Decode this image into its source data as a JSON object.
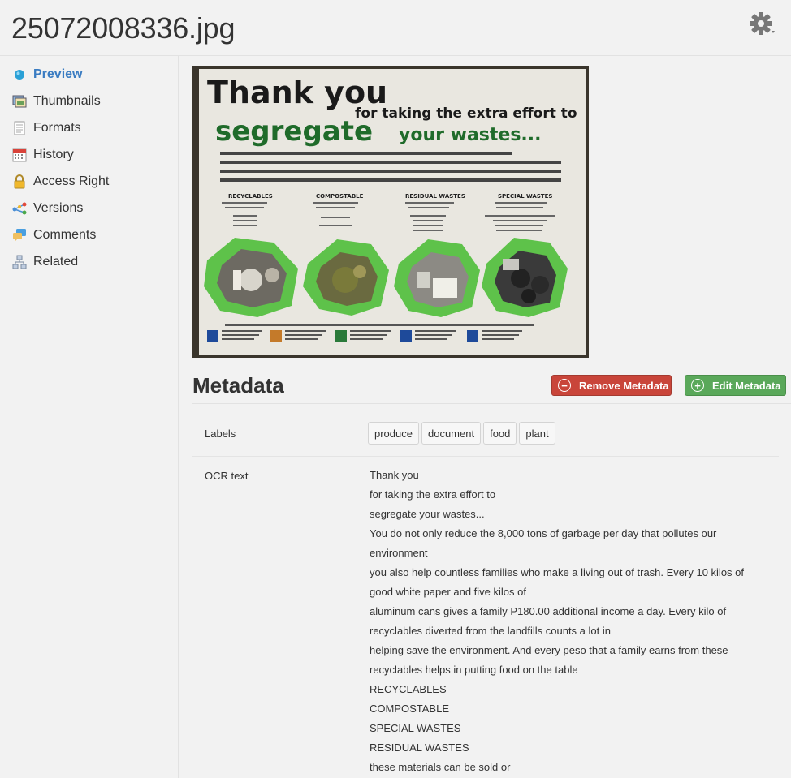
{
  "header": {
    "title": "25072008336.jpg",
    "settings_icon": "gear-icon"
  },
  "sidebar": {
    "items": [
      {
        "label": "Preview",
        "icon": "preview-icon",
        "active": true
      },
      {
        "label": "Thumbnails",
        "icon": "thumbnails-icon"
      },
      {
        "label": "Formats",
        "icon": "formats-icon"
      },
      {
        "label": "History",
        "icon": "calendar-icon"
      },
      {
        "label": "Access Right",
        "icon": "lock-icon"
      },
      {
        "label": "Versions",
        "icon": "versions-icon"
      },
      {
        "label": "Comments",
        "icon": "comments-icon"
      },
      {
        "label": "Related",
        "icon": "related-icon"
      }
    ]
  },
  "preview": {
    "poster": {
      "heading": "Thank you",
      "subheading": "for taking the extra effort to",
      "emphasis": "segregate",
      "emphasis_rest": "your wastes...",
      "categories": [
        "RECYCLABLES",
        "COMPOSTABLE",
        "RESIDUAL WASTES",
        "SPECIAL WASTES"
      ]
    }
  },
  "metadata": {
    "title": "Metadata",
    "remove_label": "Remove Metadata",
    "edit_label": "Edit Metadata",
    "labels_label": "Labels",
    "labels": [
      "produce",
      "document",
      "food",
      "plant"
    ],
    "ocr_label": "OCR text",
    "ocr_lines": [
      "Thank you",
      "for taking the extra effort to",
      "segregate your wastes...",
      "You do not only reduce the 8,000 tons of garbage per day that pollutes our",
      "environment",
      "you also help countless families who make a living out of trash. Every 10 kilos of",
      "good white paper and five kilos of",
      "aluminum cans gives a family P180.00 additional income a day. Every kilo of",
      "recyclables diverted from the landfills counts a lot in",
      "helping save the environment. And every peso that a family earns from these",
      "recyclables helps in putting food on the table",
      "RECYCLABLES",
      "COMPOSTABLE",
      "SPECIAL WASTES",
      "RESIDUAL WASTES",
      "these materials can be sold or"
    ]
  },
  "colors": {
    "active_link": "#3a7cc2",
    "remove_button": "#c9453a",
    "edit_button": "#5aa85a",
    "background": "#f2f2f2"
  }
}
